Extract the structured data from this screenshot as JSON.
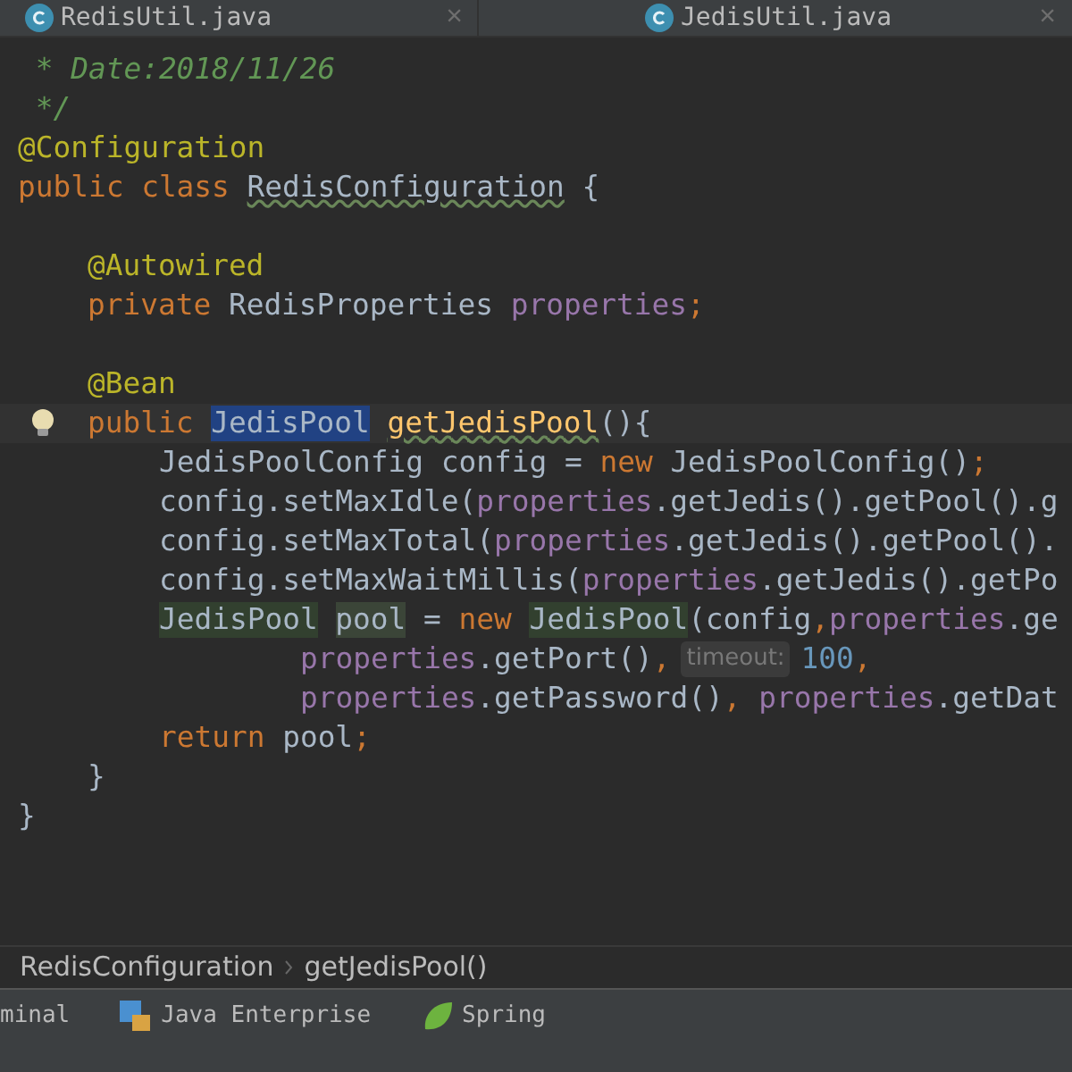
{
  "tabs": [
    {
      "label": "RedisUtil.java",
      "close": "×"
    },
    {
      "label": "JedisUtil.java",
      "close": "×"
    }
  ],
  "editor": {
    "lines": [
      {
        "kind": "top",
        "bulb": false,
        "tokens": [
          {
            "kind": "comment",
            "text": " * Date:2018/11/26"
          }
        ]
      },
      {
        "kind": "top",
        "bulb": false,
        "tokens": [
          {
            "kind": "comment",
            "text": " */"
          }
        ]
      },
      {
        "kind": "top",
        "bulb": false,
        "tokens": [
          {
            "kind": "annotation",
            "text": "@Configuration"
          }
        ]
      },
      {
        "kind": "top",
        "bulb": false,
        "tokens": [
          {
            "kind": "keyword",
            "text": "public class "
          },
          {
            "kind": "typo",
            "text": "RedisConfiguration"
          },
          {
            "kind": "plain",
            "text": " {"
          }
        ]
      },
      {
        "kind": "blank",
        "bulb": false
      },
      {
        "kind": "member",
        "bulb": false,
        "tokens": [
          {
            "kind": "annotation",
            "text": "@Autowired"
          }
        ]
      },
      {
        "kind": "member",
        "bulb": false,
        "tokens": [
          {
            "kind": "keyword",
            "text": "private "
          },
          {
            "kind": "plain",
            "text": "RedisProperties "
          },
          {
            "kind": "field",
            "text": "properties"
          },
          {
            "kind": "keyword",
            "text": ";"
          }
        ]
      },
      {
        "kind": "blank",
        "bulb": false
      },
      {
        "kind": "member",
        "bulb": false,
        "tokens": [
          {
            "kind": "annotation",
            "text": "@Bean"
          }
        ]
      },
      {
        "kind": "member",
        "bulb": true,
        "tokens": [
          {
            "kind": "keyword",
            "text": "public "
          },
          {
            "kind": "selected",
            "text": "JedisPool"
          },
          {
            "kind": "method",
            "text": "getJedisPool"
          },
          {
            "kind": "plain",
            "text": "(){"
          }
        ]
      },
      {
        "kind": "body",
        "bulb": false,
        "tokens": [
          {
            "kind": "plain",
            "text": "JedisPoolConfig config = "
          },
          {
            "kind": "keyword",
            "text": "new "
          },
          {
            "kind": "plain",
            "text": "JedisPoolConfig()"
          },
          {
            "kind": "keyword",
            "text": ";"
          }
        ]
      },
      {
        "kind": "body",
        "bulb": false,
        "tokens": [
          {
            "kind": "plain",
            "text": "config.setMaxIdle("
          },
          {
            "kind": "field",
            "text": "properties"
          },
          {
            "kind": "plain",
            "text": ".getJedis().getPool().g"
          }
        ]
      },
      {
        "kind": "body",
        "bulb": false,
        "tokens": [
          {
            "kind": "plain",
            "text": "config.setMaxTotal("
          },
          {
            "kind": "field",
            "text": "properties"
          },
          {
            "kind": "plain",
            "text": ".getJedis().getPool()."
          }
        ]
      },
      {
        "kind": "body",
        "bulb": false,
        "tokens": [
          {
            "kind": "plain",
            "text": "config.setMaxWaitMillis("
          },
          {
            "kind": "field",
            "text": "properties"
          },
          {
            "kind": "plain",
            "text": ".getJedis().getPo"
          }
        ]
      },
      {
        "kind": "body",
        "bulb": false,
        "tokens": [
          {
            "kind": "usage-decl",
            "text": "JedisPool"
          },
          {
            "kind": "usage-var",
            "text": "pool"
          },
          {
            "kind": "plain",
            "text": " = "
          },
          {
            "kind": "keyword",
            "text": "new "
          },
          {
            "kind": "usage",
            "text": "JedisPool"
          },
          {
            "kind": "plain",
            "text": "(config"
          },
          {
            "kind": "keyword",
            "text": ","
          },
          {
            "kind": "field",
            "text": "properties"
          },
          {
            "kind": "plain",
            "text": ".ge"
          }
        ]
      },
      {
        "kind": "continuation",
        "bulb": false,
        "tokens": [
          {
            "kind": "field",
            "text": "properties"
          },
          {
            "kind": "plain",
            "text": ".getPort()"
          },
          {
            "kind": "keyword",
            "text": ","
          },
          {
            "kind": "hint",
            "text": "timeout:"
          },
          {
            "kind": "number",
            "text": "100"
          },
          {
            "kind": "keyword",
            "text": ","
          }
        ]
      },
      {
        "kind": "continuation",
        "bulb": false,
        "tokens": [
          {
            "kind": "field",
            "text": "properties"
          },
          {
            "kind": "plain",
            "text": ".getPassword()"
          },
          {
            "kind": "keyword",
            "text": ", "
          },
          {
            "kind": "field",
            "text": "properties"
          },
          {
            "kind": "plain",
            "text": ".getDat"
          }
        ]
      },
      {
        "kind": "body",
        "bulb": false,
        "tokens": [
          {
            "kind": "keyword",
            "text": "return "
          },
          {
            "kind": "plain",
            "text": "pool"
          },
          {
            "kind": "keyword",
            "text": ";"
          }
        ]
      },
      {
        "kind": "member",
        "bulb": false,
        "tokens": [
          {
            "kind": "plain",
            "text": "}"
          }
        ]
      },
      {
        "kind": "top",
        "bulb": false,
        "tokens": [
          {
            "kind": "plain",
            "text": "}"
          }
        ]
      }
    ]
  },
  "breadcrumbs": [
    "RedisConfiguration",
    "getJedisPool()"
  ],
  "tool_windows": [
    {
      "kind": "terminal",
      "label": "minal"
    },
    {
      "kind": "enterprise",
      "label": "Java Enterprise"
    },
    {
      "kind": "spring",
      "label": "Spring"
    }
  ]
}
